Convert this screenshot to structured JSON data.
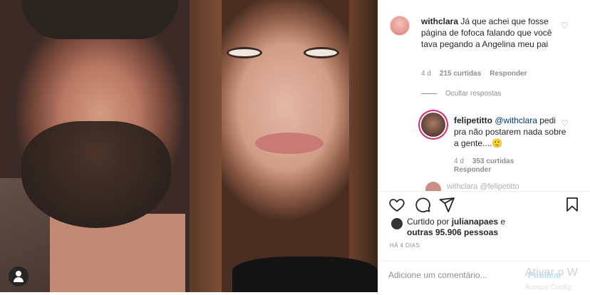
{
  "post": {
    "comment1": {
      "username": "withclara",
      "text": "Já que achei que fosse página de fofoca falando que você tava pegando a Angelina meu pai",
      "time": "4 d",
      "likes": "215 curtidas",
      "reply": "Responder"
    },
    "hide_replies": "Ocultar respostas",
    "reply1": {
      "username": "felipetitto",
      "mention": "@withclara",
      "text": "pedi pra não postarem nada sobre a gente....🙂",
      "time": "4 d",
      "likes": "353 curtidas",
      "reply": "Responder"
    },
    "peek_text": "withclara @felipetitto",
    "liked_by_prefix": "Curtido por",
    "liked_by_user": "julianapaes",
    "liked_by_suffix": "e",
    "liked_others": "outras 95.906 pessoas",
    "timestamp": "HÁ 4 DIAS",
    "add_comment_placeholder": "Adicione um comentário...",
    "publish": "Publicar",
    "watermark_line1": "Ativar o W",
    "watermark_line2": "Acesse Config"
  },
  "icons": {
    "like": "heart-icon",
    "comment": "comment-bubble-icon",
    "share": "paper-plane-icon",
    "save": "bookmark-icon",
    "tag": "user-tag-icon"
  },
  "colors": {
    "text": "#262626",
    "muted": "#8e8e8e",
    "publish_disabled": "#b2dffc",
    "story_ring": "#d62976"
  }
}
